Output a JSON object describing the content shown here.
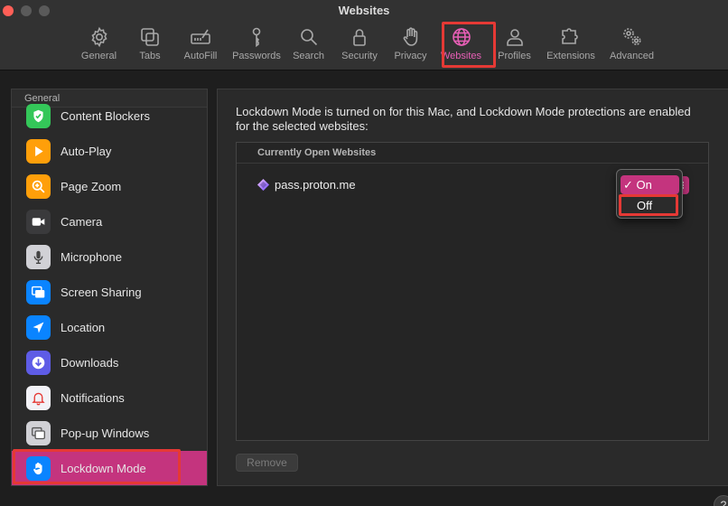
{
  "window": {
    "title": "Websites"
  },
  "toolbar": {
    "items": [
      {
        "label": "General",
        "icon": "gear-icon"
      },
      {
        "label": "Tabs",
        "icon": "tabs-icon"
      },
      {
        "label": "AutoFill",
        "icon": "autofill-icon"
      },
      {
        "label": "Passwords",
        "icon": "key-icon"
      },
      {
        "label": "Search",
        "icon": "search-icon"
      },
      {
        "label": "Security",
        "icon": "lock-icon"
      },
      {
        "label": "Privacy",
        "icon": "hand-icon"
      },
      {
        "label": "Websites",
        "icon": "globe-icon",
        "selected": true
      },
      {
        "label": "Profiles",
        "icon": "person-icon"
      },
      {
        "label": "Extensions",
        "icon": "puzzle-icon"
      },
      {
        "label": "Advanced",
        "icon": "gears-icon"
      }
    ]
  },
  "sidebar": {
    "header": "General",
    "items": [
      {
        "label": "Content Blockers",
        "icon": "shield-check-icon",
        "color": "#34c759"
      },
      {
        "label": "Auto-Play",
        "icon": "play-icon",
        "color": "#ff9f0a"
      },
      {
        "label": "Page Zoom",
        "icon": "zoom-icon",
        "color": "#ff9f0a"
      },
      {
        "label": "Camera",
        "icon": "camera-icon",
        "color": "#3a3a3c"
      },
      {
        "label": "Microphone",
        "icon": "microphone-icon",
        "color": "#d1d1d6"
      },
      {
        "label": "Screen Sharing",
        "icon": "screen-sharing-icon",
        "color": "#0a84ff"
      },
      {
        "label": "Location",
        "icon": "location-arrow-icon",
        "color": "#0a84ff"
      },
      {
        "label": "Downloads",
        "icon": "download-icon",
        "color": "#5e5ce6"
      },
      {
        "label": "Notifications",
        "icon": "bell-icon",
        "color": "#f2f2f7"
      },
      {
        "label": "Pop-up Windows",
        "icon": "popup-windows-icon",
        "color": "#d1d1d6"
      },
      {
        "label": "Lockdown Mode",
        "icon": "hand-raised-icon",
        "color": "#0a84ff",
        "selected": true
      }
    ]
  },
  "main": {
    "description": "Lockdown Mode is turned on for this Mac, and Lockdown Mode protections are enabled for the selected websites:",
    "sites_header": "Currently Open Websites",
    "sites": [
      {
        "domain": "pass.proton.me"
      }
    ],
    "dropdown": {
      "options": [
        "On",
        "Off"
      ],
      "checked": "On",
      "checkmark": "✓"
    },
    "remove_label": "Remove"
  },
  "help_label": "?",
  "colors": {
    "accent": "#c4347e",
    "highlight_box": "#e53935"
  }
}
